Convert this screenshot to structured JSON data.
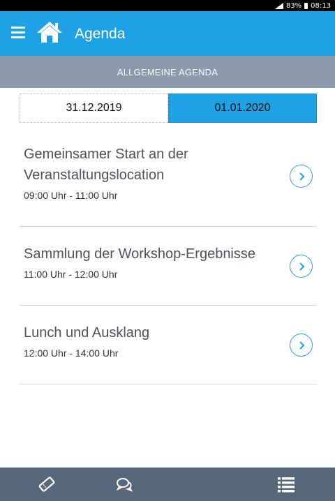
{
  "status_bar": {
    "battery": "83%",
    "time": "08:13"
  },
  "header": {
    "title": "Agenda",
    "menu_icon": "hamburger-menu-icon",
    "home_icon": "home-icon"
  },
  "section": {
    "label": "ALLGEMEINE AGENDA"
  },
  "date_tabs": [
    {
      "label": "31.12.2019",
      "selected": false
    },
    {
      "label": "01.01.2020",
      "selected": true
    }
  ],
  "agenda": [
    {
      "title": "Gemeinsamer Start an der Veranstaltungslocation",
      "time": "09:00 Uhr - 11:00 Uhr"
    },
    {
      "title": "Sammlung der Workshop-Ergebnisse",
      "time": "11:00 Uhr - 12:00 Uhr"
    },
    {
      "title": "Lunch und Ausklang",
      "time": "12:00 Uhr - 14:00 Uhr"
    }
  ],
  "bottom_nav": [
    {
      "icon": "ticket-icon"
    },
    {
      "icon": "chat-bubbles-icon"
    },
    {
      "icon": "agenda-list-icon"
    }
  ],
  "colors": {
    "primary": "#1ea2e5",
    "section_bar": "#8a9aaa",
    "bottom_bar": "#56677a"
  }
}
